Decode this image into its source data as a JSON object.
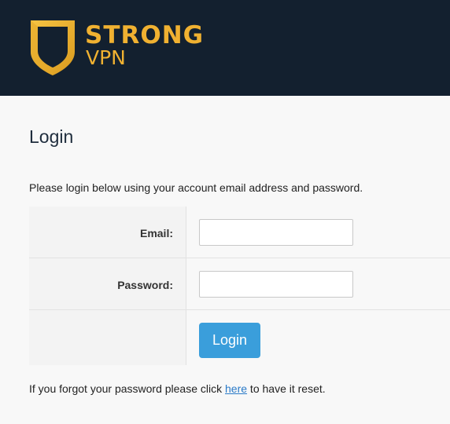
{
  "header": {
    "logo_word_1": "STRONG",
    "logo_word_2": "VPN",
    "logo_color": "#f0b131",
    "background": "#13202f"
  },
  "page": {
    "title": "Login",
    "intro": "Please login below using your account email address and password."
  },
  "form": {
    "email_label": "Email:",
    "email_value": "",
    "password_label": "Password:",
    "password_value": "",
    "login_button": "Login",
    "button_color": "#3a9edb"
  },
  "footer": {
    "forgot_before": "If you forgot your password please click ",
    "forgot_link": "here",
    "forgot_after": " to have it reset."
  }
}
